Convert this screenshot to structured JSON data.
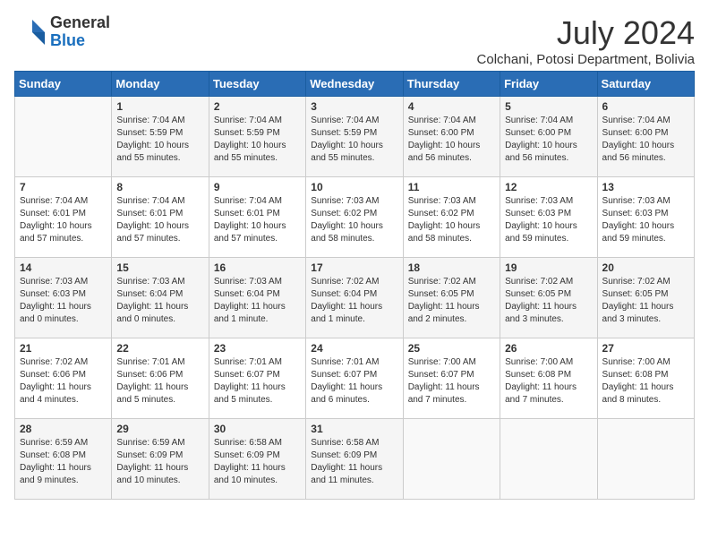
{
  "header": {
    "logo_line1": "General",
    "logo_line2": "Blue",
    "month_year": "July 2024",
    "location": "Colchani, Potosi Department, Bolivia"
  },
  "weekdays": [
    "Sunday",
    "Monday",
    "Tuesday",
    "Wednesday",
    "Thursday",
    "Friday",
    "Saturday"
  ],
  "weeks": [
    [
      {
        "day": "",
        "sunrise": "",
        "sunset": "",
        "daylight": ""
      },
      {
        "day": "1",
        "sunrise": "7:04 AM",
        "sunset": "5:59 PM",
        "daylight": "10 hours and 55 minutes."
      },
      {
        "day": "2",
        "sunrise": "7:04 AM",
        "sunset": "5:59 PM",
        "daylight": "10 hours and 55 minutes."
      },
      {
        "day": "3",
        "sunrise": "7:04 AM",
        "sunset": "5:59 PM",
        "daylight": "10 hours and 55 minutes."
      },
      {
        "day": "4",
        "sunrise": "7:04 AM",
        "sunset": "6:00 PM",
        "daylight": "10 hours and 56 minutes."
      },
      {
        "day": "5",
        "sunrise": "7:04 AM",
        "sunset": "6:00 PM",
        "daylight": "10 hours and 56 minutes."
      },
      {
        "day": "6",
        "sunrise": "7:04 AM",
        "sunset": "6:00 PM",
        "daylight": "10 hours and 56 minutes."
      }
    ],
    [
      {
        "day": "7",
        "sunrise": "7:04 AM",
        "sunset": "6:01 PM",
        "daylight": "10 hours and 57 minutes."
      },
      {
        "day": "8",
        "sunrise": "7:04 AM",
        "sunset": "6:01 PM",
        "daylight": "10 hours and 57 minutes."
      },
      {
        "day": "9",
        "sunrise": "7:04 AM",
        "sunset": "6:01 PM",
        "daylight": "10 hours and 57 minutes."
      },
      {
        "day": "10",
        "sunrise": "7:03 AM",
        "sunset": "6:02 PM",
        "daylight": "10 hours and 58 minutes."
      },
      {
        "day": "11",
        "sunrise": "7:03 AM",
        "sunset": "6:02 PM",
        "daylight": "10 hours and 58 minutes."
      },
      {
        "day": "12",
        "sunrise": "7:03 AM",
        "sunset": "6:03 PM",
        "daylight": "10 hours and 59 minutes."
      },
      {
        "day": "13",
        "sunrise": "7:03 AM",
        "sunset": "6:03 PM",
        "daylight": "10 hours and 59 minutes."
      }
    ],
    [
      {
        "day": "14",
        "sunrise": "7:03 AM",
        "sunset": "6:03 PM",
        "daylight": "11 hours and 0 minutes."
      },
      {
        "day": "15",
        "sunrise": "7:03 AM",
        "sunset": "6:04 PM",
        "daylight": "11 hours and 0 minutes."
      },
      {
        "day": "16",
        "sunrise": "7:03 AM",
        "sunset": "6:04 PM",
        "daylight": "11 hours and 1 minute."
      },
      {
        "day": "17",
        "sunrise": "7:02 AM",
        "sunset": "6:04 PM",
        "daylight": "11 hours and 1 minute."
      },
      {
        "day": "18",
        "sunrise": "7:02 AM",
        "sunset": "6:05 PM",
        "daylight": "11 hours and 2 minutes."
      },
      {
        "day": "19",
        "sunrise": "7:02 AM",
        "sunset": "6:05 PM",
        "daylight": "11 hours and 3 minutes."
      },
      {
        "day": "20",
        "sunrise": "7:02 AM",
        "sunset": "6:05 PM",
        "daylight": "11 hours and 3 minutes."
      }
    ],
    [
      {
        "day": "21",
        "sunrise": "7:02 AM",
        "sunset": "6:06 PM",
        "daylight": "11 hours and 4 minutes."
      },
      {
        "day": "22",
        "sunrise": "7:01 AM",
        "sunset": "6:06 PM",
        "daylight": "11 hours and 5 minutes."
      },
      {
        "day": "23",
        "sunrise": "7:01 AM",
        "sunset": "6:07 PM",
        "daylight": "11 hours and 5 minutes."
      },
      {
        "day": "24",
        "sunrise": "7:01 AM",
        "sunset": "6:07 PM",
        "daylight": "11 hours and 6 minutes."
      },
      {
        "day": "25",
        "sunrise": "7:00 AM",
        "sunset": "6:07 PM",
        "daylight": "11 hours and 7 minutes."
      },
      {
        "day": "26",
        "sunrise": "7:00 AM",
        "sunset": "6:08 PM",
        "daylight": "11 hours and 7 minutes."
      },
      {
        "day": "27",
        "sunrise": "7:00 AM",
        "sunset": "6:08 PM",
        "daylight": "11 hours and 8 minutes."
      }
    ],
    [
      {
        "day": "28",
        "sunrise": "6:59 AM",
        "sunset": "6:08 PM",
        "daylight": "11 hours and 9 minutes."
      },
      {
        "day": "29",
        "sunrise": "6:59 AM",
        "sunset": "6:09 PM",
        "daylight": "11 hours and 10 minutes."
      },
      {
        "day": "30",
        "sunrise": "6:58 AM",
        "sunset": "6:09 PM",
        "daylight": "11 hours and 10 minutes."
      },
      {
        "day": "31",
        "sunrise": "6:58 AM",
        "sunset": "6:09 PM",
        "daylight": "11 hours and 11 minutes."
      },
      {
        "day": "",
        "sunrise": "",
        "sunset": "",
        "daylight": ""
      },
      {
        "day": "",
        "sunrise": "",
        "sunset": "",
        "daylight": ""
      },
      {
        "day": "",
        "sunrise": "",
        "sunset": "",
        "daylight": ""
      }
    ]
  ],
  "labels": {
    "sunrise_prefix": "Sunrise: ",
    "sunset_prefix": "Sunset: ",
    "daylight_prefix": "Daylight: "
  }
}
